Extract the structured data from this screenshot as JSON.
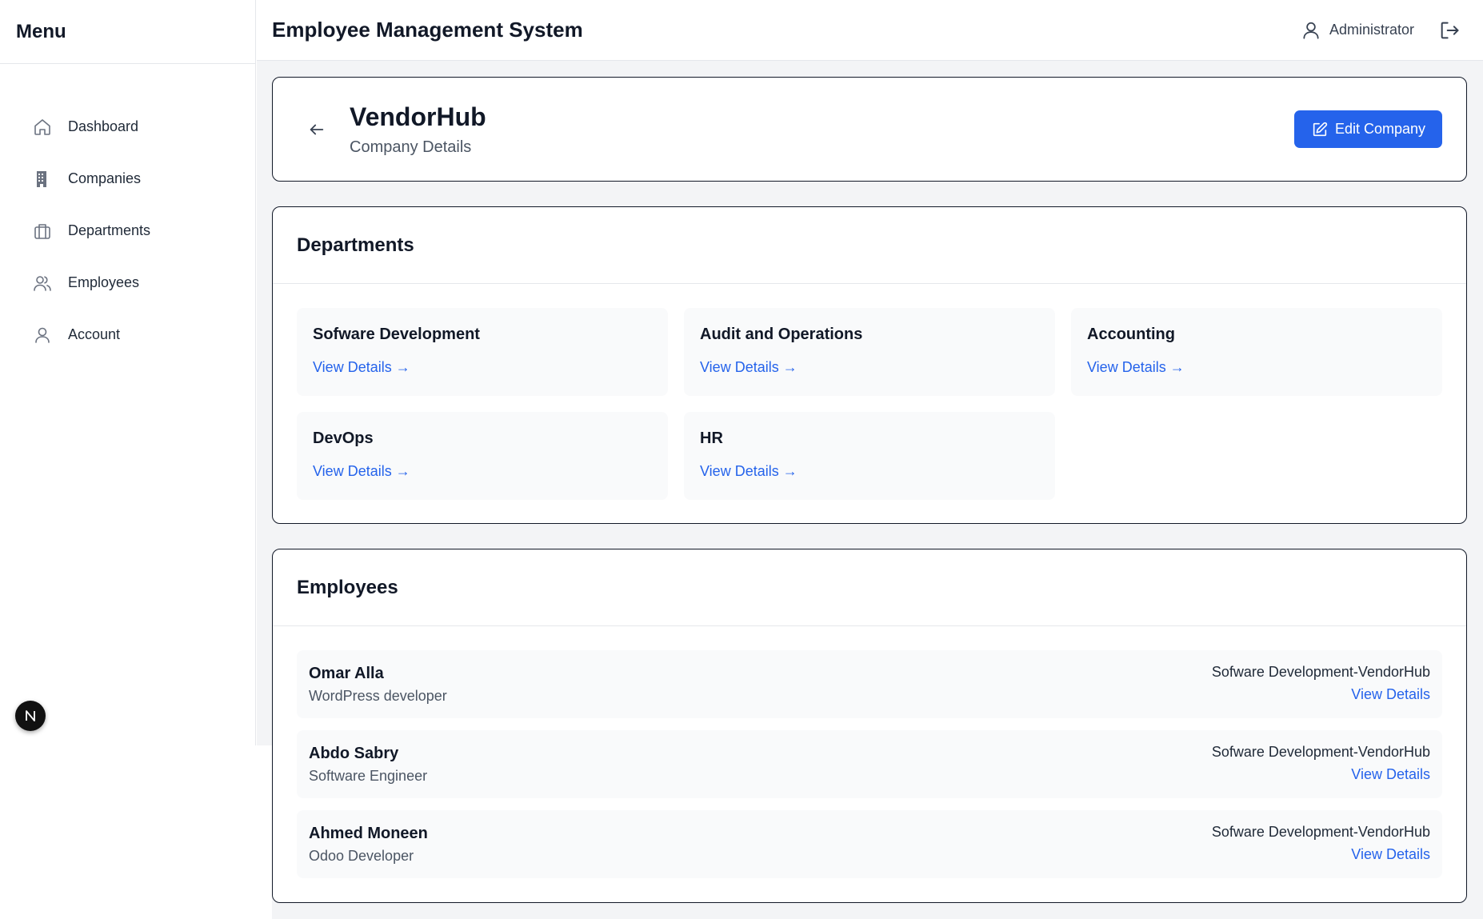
{
  "sidebar": {
    "title": "Menu",
    "items": [
      {
        "label": "Dashboard",
        "icon": "home-icon"
      },
      {
        "label": "Companies",
        "icon": "building-icon"
      },
      {
        "label": "Departments",
        "icon": "briefcase-icon"
      },
      {
        "label": "Employees",
        "icon": "users-icon"
      },
      {
        "label": "Account",
        "icon": "user-icon"
      }
    ],
    "badge_letter": "N"
  },
  "header": {
    "title": "Employee Management System",
    "user": "Administrator"
  },
  "company": {
    "name": "VendorHub",
    "subtitle": "Company Details",
    "edit_label": "Edit Company"
  },
  "departments": {
    "title": "Departments",
    "link_label": "View Details →",
    "items": [
      {
        "name": "Sofware Development"
      },
      {
        "name": "Audit and Operations"
      },
      {
        "name": "Accounting"
      },
      {
        "name": "DevOps"
      },
      {
        "name": "HR"
      }
    ]
  },
  "employees": {
    "title": "Employees",
    "link_label": "View Details",
    "items": [
      {
        "name": "Omar Alla",
        "role": "WordPress developer",
        "department": "Sofware Development-VendorHub"
      },
      {
        "name": "Abdo Sabry",
        "role": "Software Engineer",
        "department": "Sofware Development-VendorHub"
      },
      {
        "name": "Ahmed Moneen",
        "role": "Odoo Developer",
        "department": "Sofware Development-VendorHub"
      }
    ]
  },
  "colors": {
    "accent": "#2563eb",
    "background": "#f3f4f6",
    "border": "#111827"
  }
}
